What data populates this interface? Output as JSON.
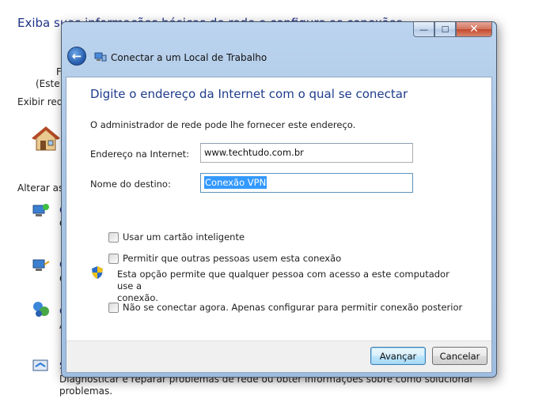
{
  "background": {
    "title": "Exiba suas informações básicas de rede e configure as conexões",
    "frag_f": "F",
    "frag_este": "(Este c",
    "frag_exibir": "Exibir rede",
    "frag_alterar": "Alterar as c",
    "frag_c1": "C",
    "frag_c2": "C",
    "frag_c3": "C",
    "frag_c4": "C",
    "frag_a": "A",
    "frag_s": "S",
    "diagnose_text": "Diagnosticar e reparar problemas de rede ou obter informações sobre como solucionar problemas.",
    "diagnose_line1": "Diagnosticar e reparar problemas de rede ou obter informações sobre como solucionar",
    "diagnose_line2": "problemas."
  },
  "dialog": {
    "window_title": "Conectar a um Local de Trabalho",
    "caption_buttons": {
      "minimize": "—",
      "maximize": "☐",
      "close": "✕"
    },
    "back_button": "←",
    "heading": "Digite o endereço da Internet com o qual se conectar",
    "description": "O administrador de rede pode lhe fornecer este endereço.",
    "fields": {
      "address_label": "Endereço na Internet:",
      "address_value": "www.techtudo.com.br",
      "destination_label": "Nome do destino:",
      "destination_value": "Conexão VPN"
    },
    "options": {
      "smart_card": {
        "label": "Usar um cartão inteligente",
        "checked": false
      },
      "allow_others": {
        "label": "Permitir que outras pessoas usem esta conexão",
        "checked": false
      },
      "allow_others_hint_line1": "Esta opção permite que qualquer pessoa com acesso a este computador use a",
      "allow_others_hint_line2": "conexão.",
      "dont_connect": {
        "label": "Não se conectar agora. Apenas configurar para permitir conexão posterior",
        "checked": false
      }
    },
    "buttons": {
      "next": "Avançar",
      "cancel": "Cancelar"
    }
  },
  "icons": {
    "back": "back-arrow-icon",
    "network_wizard": "network-connection-icon",
    "uac_shield": "uac-shield-icon",
    "home_network": "house-icon"
  },
  "colors": {
    "heading_blue": "#1e3c8c",
    "selection_blue": "#3399ff",
    "close_red": "#c3482c"
  }
}
